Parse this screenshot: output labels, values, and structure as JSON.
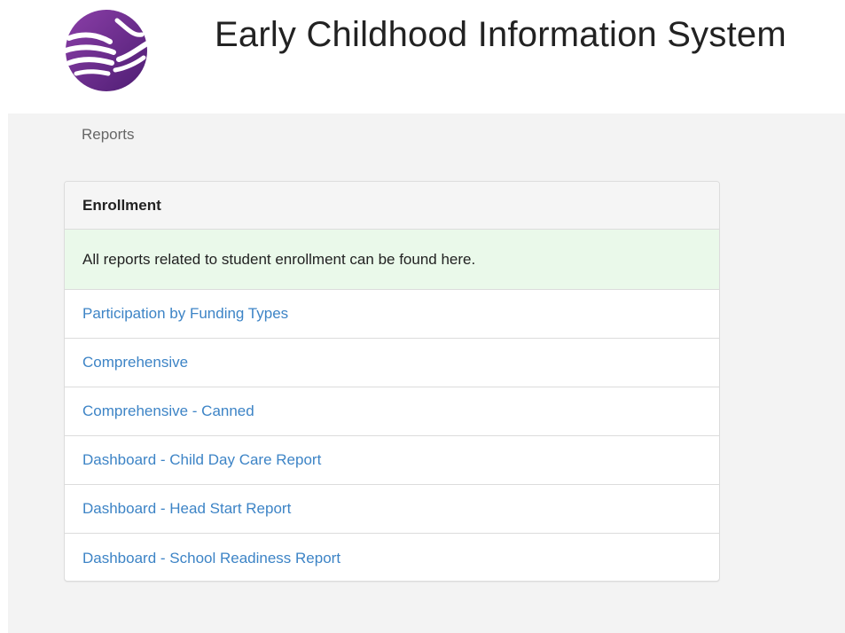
{
  "header": {
    "title": "Early Childhood Information System",
    "logo_icon": "hands-logo-icon",
    "logo_color": "#6b2a8f"
  },
  "breadcrumb": {
    "current": "Reports"
  },
  "panel": {
    "heading": "Enrollment",
    "description": "All reports related to student enrollment can be found here.",
    "description_bg": "#eaf9ea",
    "link_color": "#3d84c6",
    "reports": [
      {
        "label": "Participation by Funding Types"
      },
      {
        "label": "Comprehensive"
      },
      {
        "label": "Comprehensive - Canned"
      },
      {
        "label": "Dashboard - Child Day Care Report"
      },
      {
        "label": "Dashboard - Head Start Report"
      },
      {
        "label": "Dashboard - School Readiness Report"
      }
    ]
  }
}
